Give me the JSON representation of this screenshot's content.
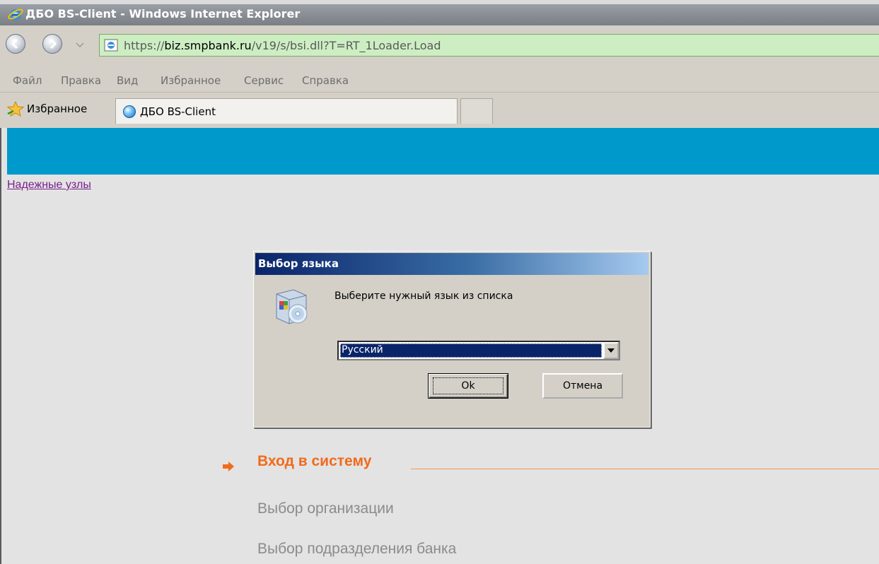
{
  "window": {
    "title": "ДБО BS-Client - Windows Internet Explorer"
  },
  "address_bar": {
    "url_prefix": "https://",
    "url_domain": "biz.smpbank.ru",
    "url_path": "/v19/s/bsi.dll?T=RT_1Loader.Load"
  },
  "menu": {
    "items": [
      {
        "label": "Файл"
      },
      {
        "label": "Правка"
      },
      {
        "label": "Вид"
      },
      {
        "label": "Избранное"
      },
      {
        "label": "Сервис"
      },
      {
        "label": "Справка"
      }
    ]
  },
  "favorites_bar": {
    "favorites_label": "Избранное",
    "tab_title": "ДБО BS-Client"
  },
  "page": {
    "trusted_sites_link": "Надежные узлы",
    "banner_color": "#0099cc",
    "steps": {
      "active": "Вход в систему",
      "next": [
        "Выбор организации",
        "Выбор подразделения банка"
      ]
    },
    "accent_color": "#f26a1b"
  },
  "dialog": {
    "title": "Выбор языка",
    "message": "Выберите нужный язык из списка",
    "selected_language": "Русский",
    "ok_label": "Ok",
    "cancel_label": "Отмена",
    "icon": "software-package-cd-icon"
  }
}
